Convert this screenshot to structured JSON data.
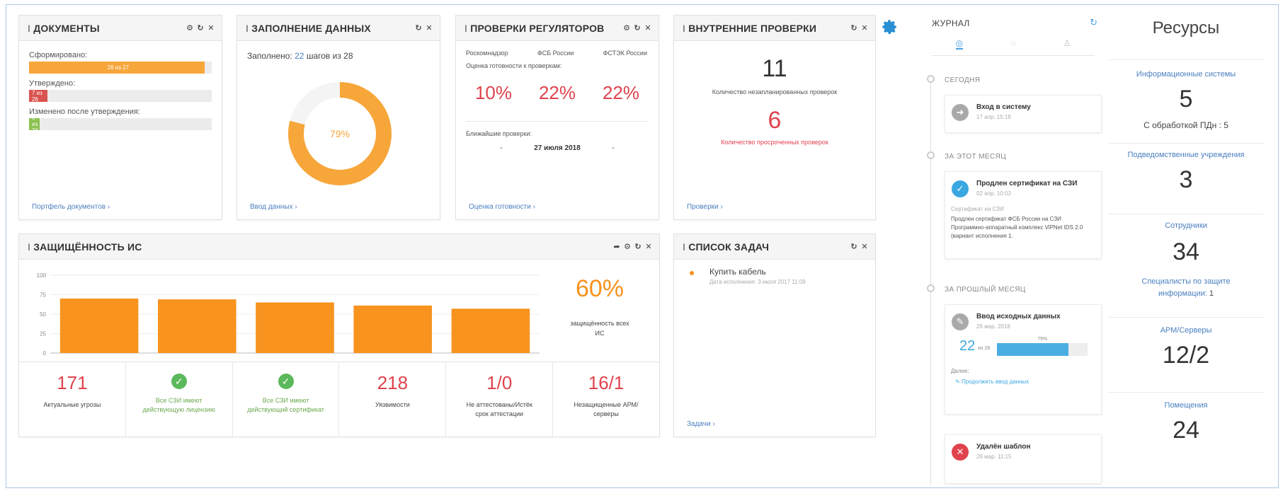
{
  "docs": {
    "title": "ДОКУМЕНТЫ",
    "formed_label": "Сформировано:",
    "formed_bar": "26 из 27",
    "formed_pct": 96,
    "approved_label": "Утверждено:",
    "approved_bar": "7 из 26",
    "approved_pct": 10,
    "changed_label": "Изменено после утверждения:",
    "changed_bar": "0 из 26",
    "changed_pct": 6,
    "link": "Портфель документов ›"
  },
  "data_fill": {
    "title": "ЗАПОЛНЕНИЕ ДАННЫХ",
    "filled_prefix": "Заполнено:",
    "filled_value": "22",
    "filled_suffix": "шагов из 28",
    "percent": "79%",
    "fraction": 0.79,
    "link": "Ввод данных ›"
  },
  "regulators": {
    "title": "ПРОВЕРКИ РЕГУЛЯТОРОВ",
    "org1": "Роскомнадзор",
    "org2": "ФСБ России",
    "org3": "ФСТЭК России",
    "readiness_label": "Оценка готовности к проверкам:",
    "p1": "10%",
    "p2": "22%",
    "p3": "22%",
    "next_label": "Ближайшие проверки:",
    "dash1": "-",
    "next_date": "27 июля 2018",
    "dash2": "-",
    "link": "Оценка готовности ›"
  },
  "internal": {
    "title": "ВНУТРЕННИЕ ПРОВЕРКИ",
    "unplanned_value": "11",
    "unplanned_label": "Количество незапланированных проверок",
    "overdue_value": "6",
    "overdue_label": "Количество просроченных проверок",
    "link": "Проверки ›"
  },
  "security": {
    "title": "ЗАЩИЩЁННОСТЬ ИС",
    "percent": "60%",
    "percent_label": "защищённость всех ИС",
    "stats": [
      {
        "value": "171",
        "label": "Актуальные угрозы",
        "kind": "num"
      },
      {
        "value": "",
        "label": "Все СЗИ имеют действующую лицензию",
        "kind": "ok"
      },
      {
        "value": "",
        "label": "Все СЗИ имеют действующий сертификат",
        "kind": "ok"
      },
      {
        "value": "218",
        "label": "Уязвимости",
        "kind": "num"
      },
      {
        "value": "1/0",
        "label": "Не аттестованы/Истёк срок аттестации",
        "kind": "num"
      },
      {
        "value": "16/1",
        "label": "Незащищенные АРМ/серверы",
        "kind": "num"
      }
    ]
  },
  "chart_data": {
    "type": "bar",
    "categories": [
      "",
      "",
      "",
      "",
      ""
    ],
    "values": [
      70,
      69,
      65,
      61,
      57
    ],
    "yticks": [
      "100",
      "75",
      "50",
      "25",
      "0"
    ],
    "ylim": [
      0,
      100
    ],
    "color": "#f7931e"
  },
  "tasks": {
    "title": "СПИСОК ЗАДАЧ",
    "items": [
      {
        "name": "Купить кабель",
        "due": "Дата исполнения: 3 июля 2017 11:09"
      }
    ],
    "link": "Задачи ›"
  },
  "journal": {
    "title": "ЖУРНАЛ",
    "sec_today": "СЕГОДНЯ",
    "sec_month": "ЗА ЭТОТ МЕСЯЦ",
    "sec_last": "ЗА ПРОШЛЫЙ МЕСЯЦ",
    "e1_title": "Вход в систему",
    "e1_date": "17 апр. 15:18",
    "e2_title": "Продлен сертификат на СЗИ",
    "e2_date": "02 апр. 10:03",
    "e2_sub": "Сертификат на СЗИ",
    "e2_body": "Продлен сертификат ФСБ России на СЗИ Программно-аппаратный комплекс ViPNet IDS 2.0 (вариант исполнения 1.",
    "e3_title": "Ввод исходных данных",
    "e3_date": "26 мар. 2018",
    "e3_value": "22",
    "e3_of": "из 28",
    "e3_pct": "79%",
    "e3_fraction": 0.79,
    "e3_more": "Далее:",
    "e3_action": "Продолжить ввод данных",
    "e4_title": "Удалён шаблон",
    "e4_date": "26 мар. 11:15"
  },
  "resources": {
    "title": "Ресурсы",
    "is_label": "Информационные системы",
    "is_value": "5",
    "is_sub": "С обработкой ПДн : 5",
    "sub_label": "Подведомственные учреждения",
    "sub_value": "3",
    "emp_label": "Сотрудники",
    "emp_value": "34",
    "spec_label": "Специалисты по защите информации:",
    "spec_value": "1",
    "arm_label": "АРМ/Серверы",
    "arm_value": "12/2",
    "room_label": "Помещения",
    "room_value": "24"
  }
}
